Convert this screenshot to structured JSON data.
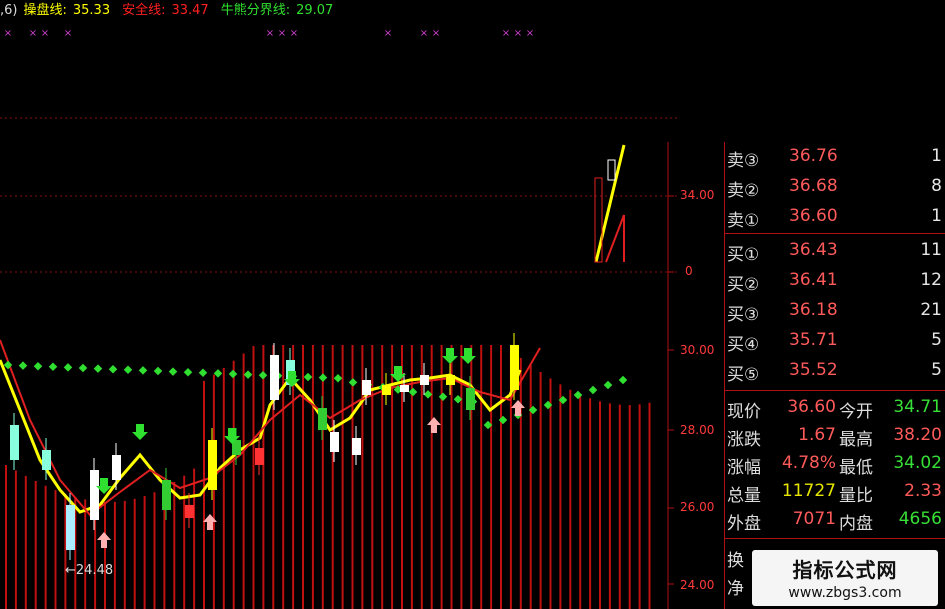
{
  "legend": {
    "prefix": ",6)",
    "line1_label": "操盘线:",
    "line1_value": "35.33",
    "line2_label": "安全线:",
    "line2_value": "33.47",
    "line3_label": "牛熊分界线:",
    "line3_value": "29.07",
    "colors": {
      "line1": "#ffff00",
      "line2": "#ff2020",
      "line3": "#30e030"
    }
  },
  "y_axis": {
    "labels": [
      "34.00",
      "0",
      "30.00",
      "28.00",
      "26.00",
      "24.00"
    ]
  },
  "low_marker": "←24.48",
  "order_book": {
    "sell": [
      {
        "label": "卖③",
        "price": "36.76",
        "volume": "1"
      },
      {
        "label": "卖②",
        "price": "36.68",
        "volume": "8"
      },
      {
        "label": "卖①",
        "price": "36.60",
        "volume": "1"
      }
    ],
    "buy": [
      {
        "label": "买①",
        "price": "36.43",
        "volume": "11"
      },
      {
        "label": "买②",
        "price": "36.41",
        "volume": "12"
      },
      {
        "label": "买③",
        "price": "36.18",
        "volume": "21"
      },
      {
        "label": "买④",
        "price": "35.71",
        "volume": "5"
      },
      {
        "label": "买⑤",
        "price": "35.52",
        "volume": "5"
      }
    ]
  },
  "stats": [
    {
      "l1": "现价",
      "v1": "36.60",
      "l2": "今开",
      "v2": "34.71"
    },
    {
      "l1": "涨跌",
      "v1": "1.67",
      "l2": "最高",
      "v2": "38.20"
    },
    {
      "l1": "涨幅",
      "v1": "4.78%",
      "l2": "最低",
      "v2": "34.02"
    },
    {
      "l1": "总量",
      "v1": "11727",
      "l2": "量比",
      "v2": "2.33"
    },
    {
      "l1": "外盘",
      "v1": "7071",
      "l2": "内盘",
      "v2": "4656"
    }
  ],
  "bottom_labels": [
    "换",
    "净"
  ],
  "watermark": {
    "title": "指标公式网",
    "url": "www.zbgs3.com"
  }
}
